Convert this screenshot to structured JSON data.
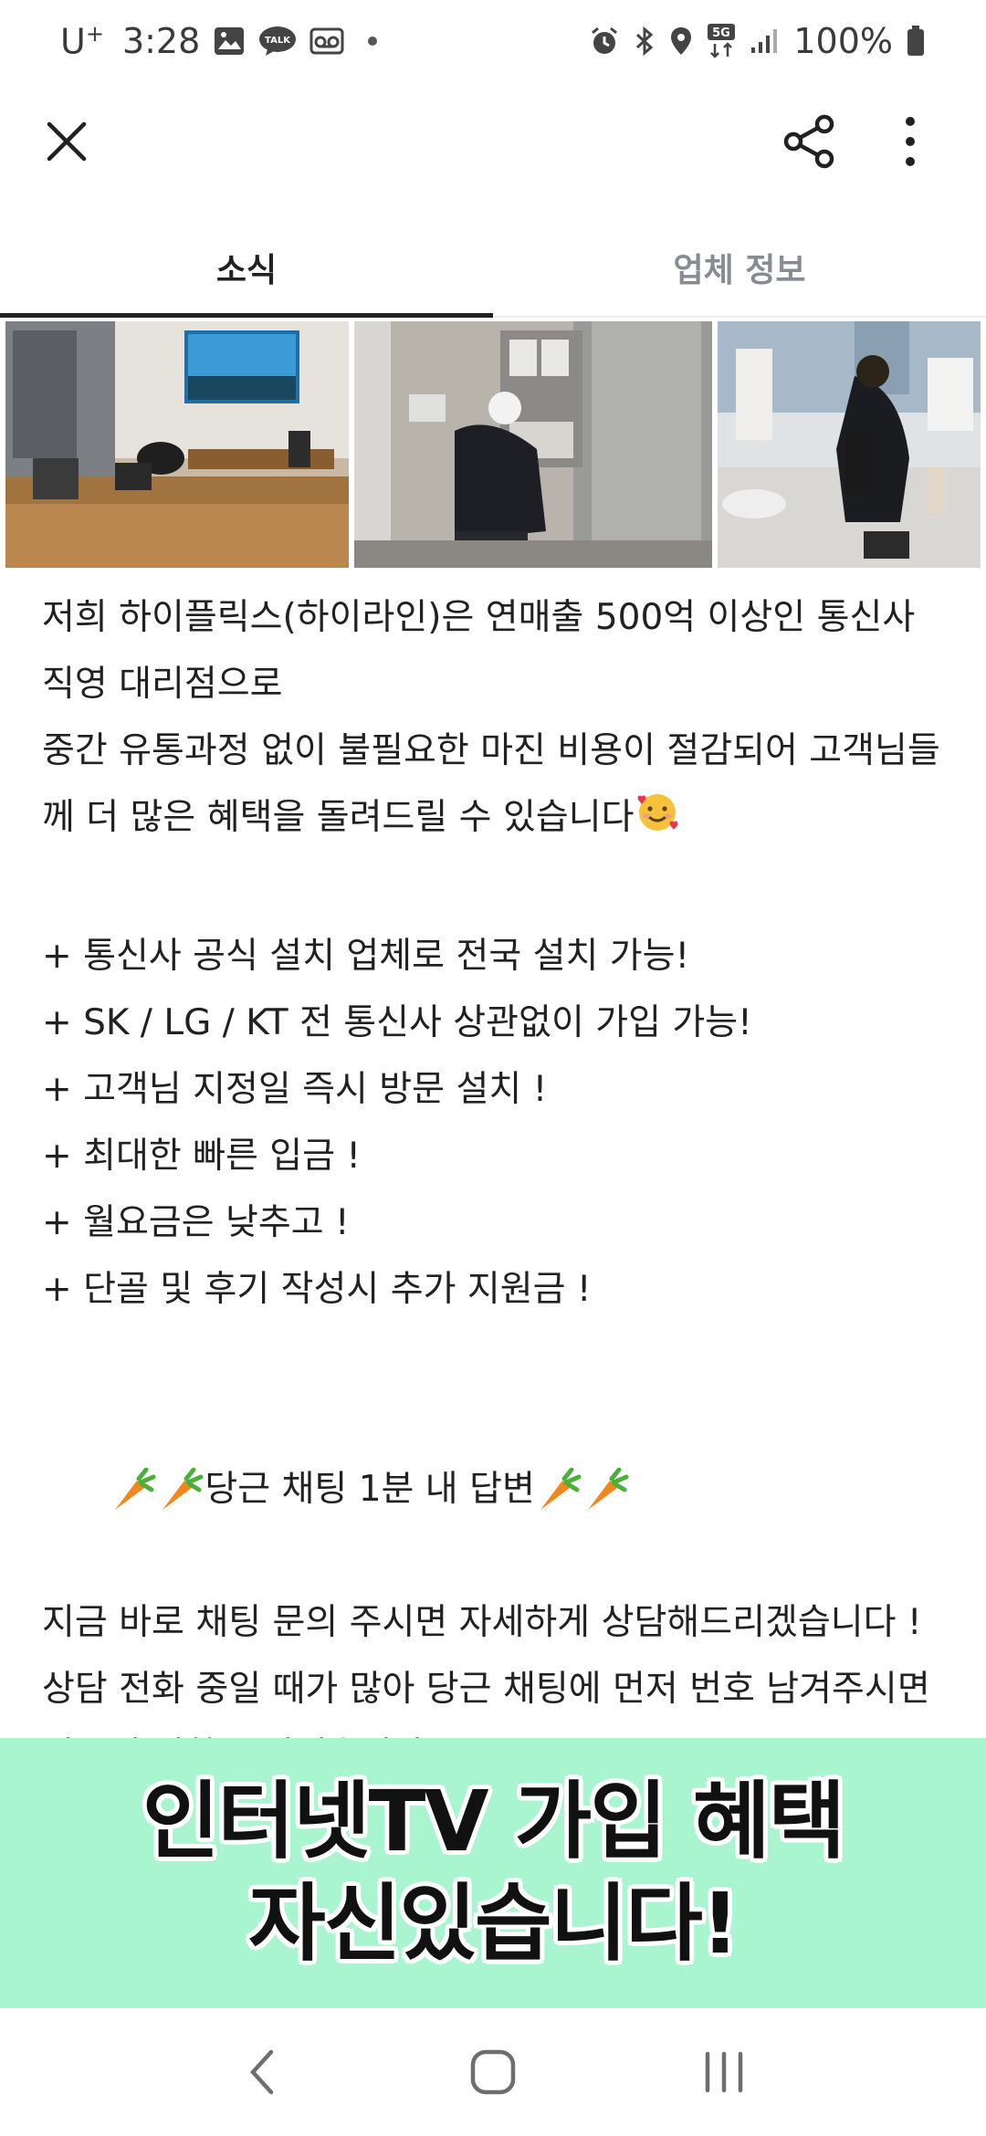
{
  "status_bar": {
    "carrier": "U",
    "carrier_sup": "+",
    "time": "3:28",
    "battery": "100%",
    "network": "5G"
  },
  "app_bar": {
    "close_icon": "close-icon",
    "share_icon": "share-icon",
    "more_icon": "more-vertical-icon"
  },
  "tabs": [
    {
      "label": "소식",
      "active": true
    },
    {
      "label": "업체 정보",
      "active": false
    }
  ],
  "post": {
    "intro_1": "저희 하이플릭스(하이라인)은 연매출 500억 이상인 통신사 직영 대리점으로",
    "intro_2": "중간 유통과정 없이 불필요한 마진 비용이 절감되어 고객님들께 더 많은 혜택을 돌려드릴 수 있습니다",
    "benefits": [
      "+ 통신사 공식 설치 업체로 전국 설치 가능!",
      "+ SK / LG / KT 전 통신사 상관없이 가입 가능!",
      "+ 고객님 지정일 즉시 방문 설치 !",
      "+ 최대한 빠른 입금 !",
      "+ 월요금은 낮추고 !",
      "+ 단골 및 후기 작성시 추가 지원금 !"
    ],
    "chat_headline": "당근 채팅 1분 내 답변",
    "chat_line_1": "지금 바로 채팅 문의 주시면 자세하게 상담해드리겠습니다 !",
    "chat_line_2": "상담 전화 중일 때가 많아 당근 채팅에 먼저 번호 남겨주시면 빠르게 전화 드리겠습니다."
  },
  "banner": {
    "line_1": "인터넷TV 가입 혜택",
    "line_2": "자신있습니다!",
    "background": "#a9f5cf"
  },
  "nav": {
    "back_icon": "back-icon",
    "home_icon": "home-icon",
    "recents_icon": "recents-icon"
  }
}
